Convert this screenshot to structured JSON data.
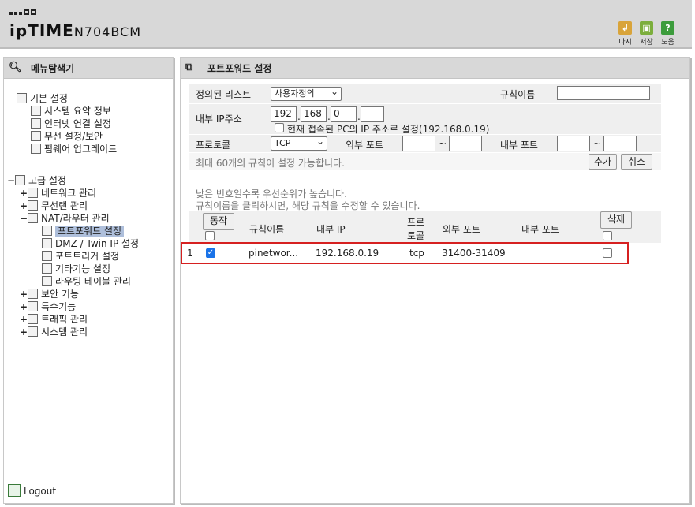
{
  "header": {
    "brand": "ipTIME",
    "model": "N704BCM",
    "buttons": [
      {
        "label": "다시",
        "icon": "refresh-icon",
        "color": "#d9a43a"
      },
      {
        "label": "저장",
        "icon": "save-icon",
        "color": "#7cae3c"
      },
      {
        "label": "도움",
        "icon": "help-icon",
        "color": "#3c9c3c"
      }
    ]
  },
  "sidebar": {
    "title": "메뉴탐색기",
    "basic": {
      "label": "기본 설정",
      "items": [
        "시스템 요약 정보",
        "인터넷 연결 설정",
        "무선 설정/보안",
        "펌웨어 업그레이드"
      ]
    },
    "advanced": {
      "label": "고급 설정",
      "items": [
        {
          "label": "네트워크 관리",
          "exp": "+"
        },
        {
          "label": "무선랜 관리",
          "exp": "+"
        },
        {
          "label": "NAT/라우터 관리",
          "exp": "−"
        }
      ],
      "nat_items": [
        "포트포워드 설정",
        "DMZ / Twin IP 설정",
        "포트트리거 설정",
        "기타기능 설정",
        "라우팅 테이블 관리"
      ],
      "more_items": [
        {
          "label": "보안 기능",
          "exp": "+"
        },
        {
          "label": "특수기능",
          "exp": "+"
        },
        {
          "label": "트래픽 관리",
          "exp": "+"
        },
        {
          "label": "시스템 관리",
          "exp": "+"
        }
      ]
    },
    "logout": "Logout"
  },
  "main": {
    "title": "포트포워드 설정",
    "form": {
      "preset_label": "정의된 리스트",
      "preset_value": "사용자정의",
      "rule_name_label": "규칙이름",
      "rule_name_value": "",
      "internal_ip_label": "내부 IP주소",
      "ip1": "192",
      "ip2": "168",
      "ip3": "0",
      "ip4": "",
      "current_pc_label": "현재 접속된 PC의 IP 주소로 설정(192.168.0.19)",
      "protocol_label": "프로토콜",
      "protocol_value": "TCP",
      "external_port_label": "외부 포트",
      "internal_port_label": "내부 포트",
      "tilde": "~",
      "max_note": "최대 60개의 규칙이 설정 가능합니다.",
      "add_button": "추가",
      "cancel_button": "취소"
    },
    "notes": [
      "낮은 번호일수록 우선순위가 높습니다.",
      "규칙이름을 클릭하시면, 해당 규칙을 수정할 수 있습니다."
    ],
    "table": {
      "action_button": "동작",
      "columns": [
        "규칙이름",
        "내부 IP",
        "프로",
        "토콜",
        "외부 포트",
        "내부 포트"
      ],
      "delete_button": "삭제",
      "rows": [
        {
          "no": "1",
          "enabled": true,
          "name": "pinetwor...",
          "ip": "192.168.0.19",
          "protocol": "tcp",
          "ext_port": "31400-31409",
          "int_port": ""
        }
      ]
    }
  }
}
